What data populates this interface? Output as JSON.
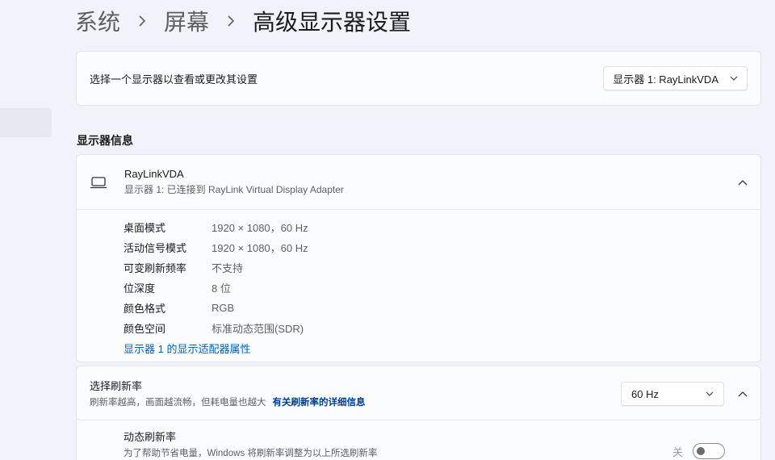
{
  "breadcrumb": [
    "系统",
    "屏幕",
    "高级显示器设置"
  ],
  "select_display": {
    "label": "选择一个显示器以查看或更改其设置",
    "dropdown_value": "显示器 1: RayLinkVDA"
  },
  "section_title": "显示器信息",
  "display_info": {
    "name": "RayLinkVDA",
    "subtitle": "显示器 1: 已连接到 RayLink Virtual Display Adapter",
    "specs": [
      {
        "key": "桌面模式",
        "value": "1920 × 1080，60 Hz"
      },
      {
        "key": "活动信号模式",
        "value": "1920 × 1080，60 Hz"
      },
      {
        "key": "可变刷新频率",
        "value": "不支持"
      },
      {
        "key": "位深度",
        "value": "8 位"
      },
      {
        "key": "颜色格式",
        "value": "RGB"
      },
      {
        "key": "颜色空间",
        "value": "标准动态范围(SDR)"
      }
    ],
    "adapter_link": "显示器 1 的显示适配器属性"
  },
  "refresh_rate": {
    "title": "选择刷新率",
    "description": "刷新率越高，画面越流畅，但耗电量也越大",
    "more_link": "有关刷新率的详细信息",
    "value": "60 Hz"
  },
  "dynamic_refresh": {
    "title": "动态刷新率",
    "description": "为了帮助节省电量，Windows 将刷新率调整为以上所选刷新率",
    "toggle_state_label": "关",
    "enabled": false
  },
  "colors": {
    "accent": "#005fb8",
    "background": "#f0f3f9",
    "card": "#fbfcfe"
  },
  "icons": [
    "chevron-right-icon",
    "chevron-down-icon",
    "chevron-up-icon",
    "monitor-icon"
  ]
}
